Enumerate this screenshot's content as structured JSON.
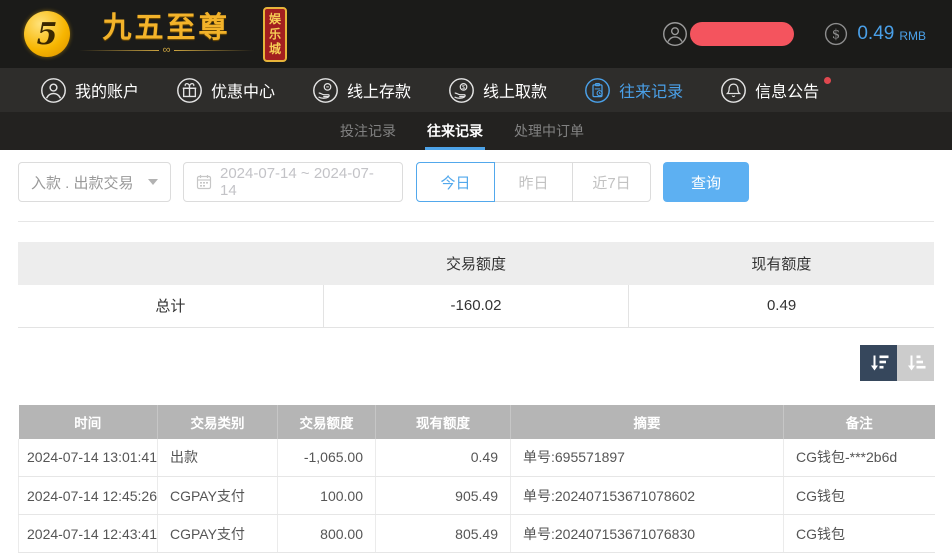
{
  "brand": {
    "monogram": "5",
    "title": "九五至尊",
    "badge": "娱乐城"
  },
  "header": {
    "balance": "0.49",
    "currency": "RMB"
  },
  "nav": {
    "items": [
      {
        "label": "我的账户"
      },
      {
        "label": "优惠中心"
      },
      {
        "label": "线上存款"
      },
      {
        "label": "线上取款"
      },
      {
        "label": "往来记录"
      },
      {
        "label": "信息公告"
      }
    ],
    "active_index": 4,
    "active_color": "#4aa0e8",
    "notice_has_dot": true
  },
  "subtabs": {
    "items": [
      {
        "label": "投注记录"
      },
      {
        "label": "往来记录"
      },
      {
        "label": "处理中订单"
      }
    ],
    "active_index": 1
  },
  "filters": {
    "type_value": "入款 . 出款交易",
    "date_value": "2024-07-14 ~ 2024-07-14",
    "quick_today": "今日",
    "quick_yesterday": "昨日",
    "quick_last7": "近7日",
    "active_quick": "今日",
    "search_label": "查询"
  },
  "summary": {
    "col_trade": "交易额度",
    "col_balance": "现有额度",
    "total_label": "总计",
    "total_trade": "-160.02",
    "total_balance": "0.49"
  },
  "table": {
    "columns": [
      "时间",
      "交易类别",
      "交易额度",
      "现有额度",
      "摘要",
      "备注"
    ],
    "rows": [
      [
        "2024-07-14 13:01:41",
        "出款",
        "-1,065.00",
        "0.49",
        "单号:695571897",
        "CG钱包-***2b6d"
      ],
      [
        "2024-07-14 12:45:26",
        "CGPAY支付",
        "100.00",
        "905.49",
        "单号:202407153671078602",
        "CG钱包"
      ],
      [
        "2024-07-14 12:43:41",
        "CGPAY支付",
        "800.00",
        "805.49",
        "单号:202407153671076830",
        "CG钱包"
      ]
    ]
  },
  "colors": {
    "accent_blue": "#4aa0e8",
    "button_blue": "#5db0f2",
    "gold": "#f3b32a",
    "redact_red": "#f4545e",
    "sort_dark": "#36475c",
    "sort_light": "#cccccc",
    "table_header_gray": "#b5b5b5"
  }
}
